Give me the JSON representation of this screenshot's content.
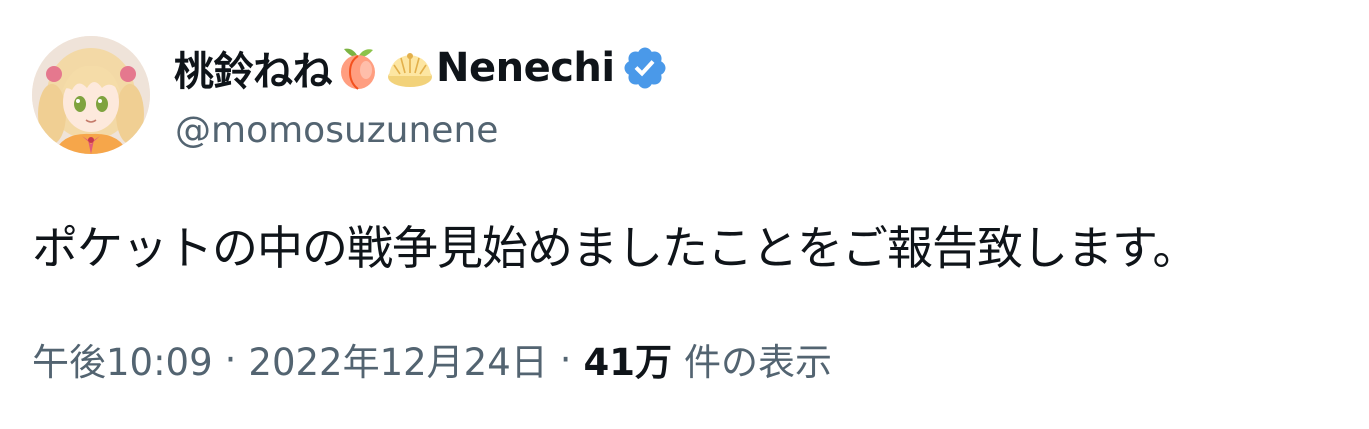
{
  "author": {
    "display_name": "桃鈴ねね",
    "display_name_suffix": "Nenechi",
    "name_emojis": [
      "peach-emoji",
      "steamed-bun-emoji"
    ],
    "handle": "@momosuzunene",
    "verified": true,
    "verified_color": "#4a99e9"
  },
  "tweet": {
    "text": "ポケットの中の戦争見始めましたことをご報告致します。"
  },
  "meta": {
    "time": "午後10:09",
    "separator": "·",
    "date": "2022年12月24日",
    "views_count": "41万",
    "views_label": "件の表示"
  },
  "colors": {
    "primary_text": "#0f1419",
    "secondary_text": "#536471",
    "background": "#ffffff"
  }
}
